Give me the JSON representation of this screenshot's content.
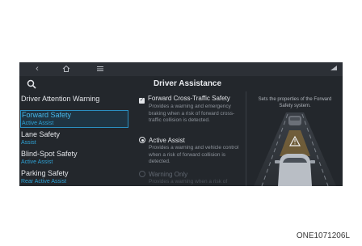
{
  "header": {
    "title": "Driver Assistance",
    "nav_icons": [
      "back-icon",
      "home-icon",
      "menu-icon"
    ],
    "status_icon": "signal-icon"
  },
  "sidebar": {
    "items": [
      {
        "label": "Driver Attention Warning",
        "sub": "",
        "selected": false
      },
      {
        "label": "Forward Safety",
        "sub": "Active Assist",
        "selected": true
      },
      {
        "label": "Lane Safety",
        "sub": "Assist",
        "selected": false
      },
      {
        "label": "Blind-Spot Safety",
        "sub": "Active Assist",
        "selected": false
      },
      {
        "label": "Parking Safety",
        "sub": "Rear Active Assist",
        "selected": false
      }
    ]
  },
  "options": {
    "cross_traffic": {
      "label": "Forward Cross-Traffic Safety",
      "desc": "Provides a warning and emergency braking when a risk of forward cross-traffic collision is detected.",
      "checked": true
    },
    "active_assist": {
      "label": "Active Assist",
      "desc": "Provides a warning and vehicle control when a risk of forward collision is detected.",
      "selected": true
    },
    "warning_only": {
      "label": "Warning Only",
      "desc": "Provides a warning when a risk of forward collision is detected.",
      "selected": false
    }
  },
  "info": {
    "description": "Sets the properties of the Forward Safety system."
  },
  "caption": "ONE1071206L",
  "colors": {
    "screen_bg": "#23272c",
    "accent": "#2fa3d6",
    "warning": "#e0a030"
  }
}
